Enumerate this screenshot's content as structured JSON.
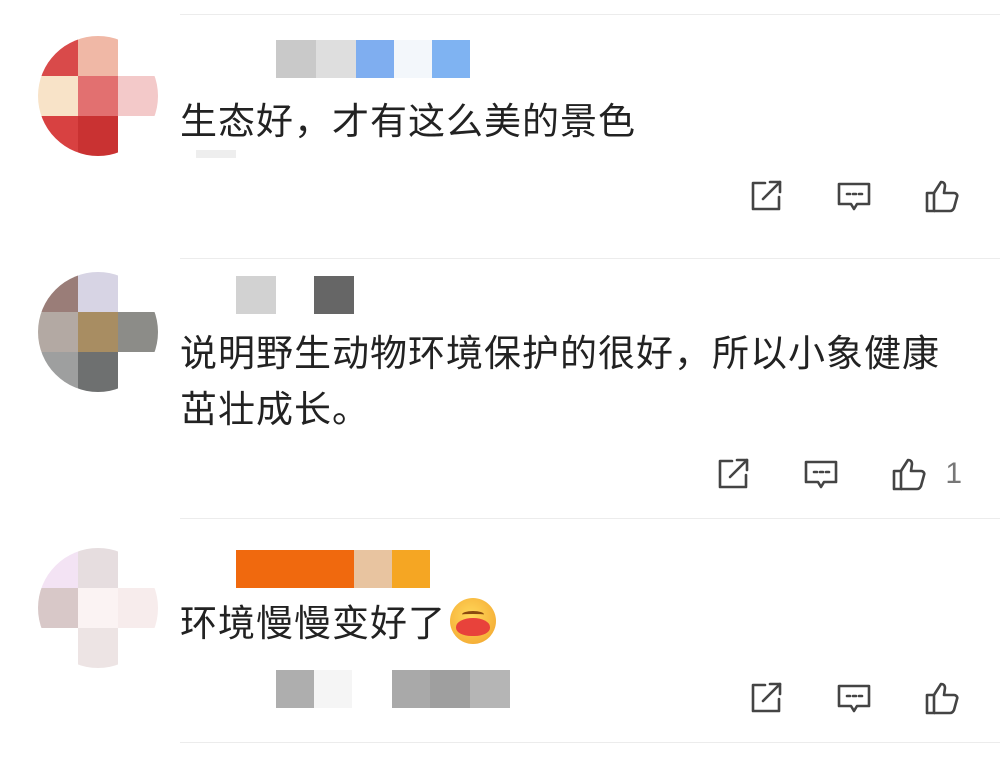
{
  "comments": [
    {
      "text": "生态好，才有这么美的景色",
      "like_count": "",
      "avatar_colors": [
        "#d94a4a",
        "#f0b8a6",
        "#ffffff",
        "#f8e3c8",
        "#e27070",
        "#f3c9c9",
        "#d84141",
        "#c93232",
        "#ffffff"
      ],
      "name_colors": [
        "#c9c9c9",
        "#dedede",
        "#7faef0",
        "#f3f7fb",
        "#7fb3f2"
      ],
      "sub_colors": [
        "#eeeeee"
      ]
    },
    {
      "text": "说明野生动物环境保护的很好，所以小象健康茁壮成长。",
      "like_count": "1",
      "avatar_colors": [
        "#9a7d78",
        "#d7d4e4",
        "#ffffff",
        "#b3a9a3",
        "#a88d62",
        "#8c8c88",
        "#9e9f9f",
        "#6e7070",
        "#ffffff"
      ],
      "name_colors": [
        "#d2d2d2",
        "#ffffff",
        "#666666"
      ],
      "sub_colors": []
    },
    {
      "text": "环境慢慢变好了",
      "like_count": "",
      "avatar_colors": [
        "#f3e3f4",
        "#e6dddf",
        "#ffffff",
        "#d8c8c8",
        "#fbf3f3",
        "#f7ecec",
        "#ffffff",
        "#ede4e4",
        "#ffffff"
      ],
      "name_colors": [
        "#f0690e",
        "#f0690e",
        "#e8c4a0",
        "#f5a623"
      ],
      "sub_colors": [
        "#aeaeae",
        "#f5f5f5",
        "#ffffff",
        "#a9a9a9",
        "#9f9f9f",
        "#b5b5b5"
      ]
    }
  ],
  "icons": {
    "share": "share-icon",
    "reply": "reply-icon",
    "like": "like-icon"
  }
}
